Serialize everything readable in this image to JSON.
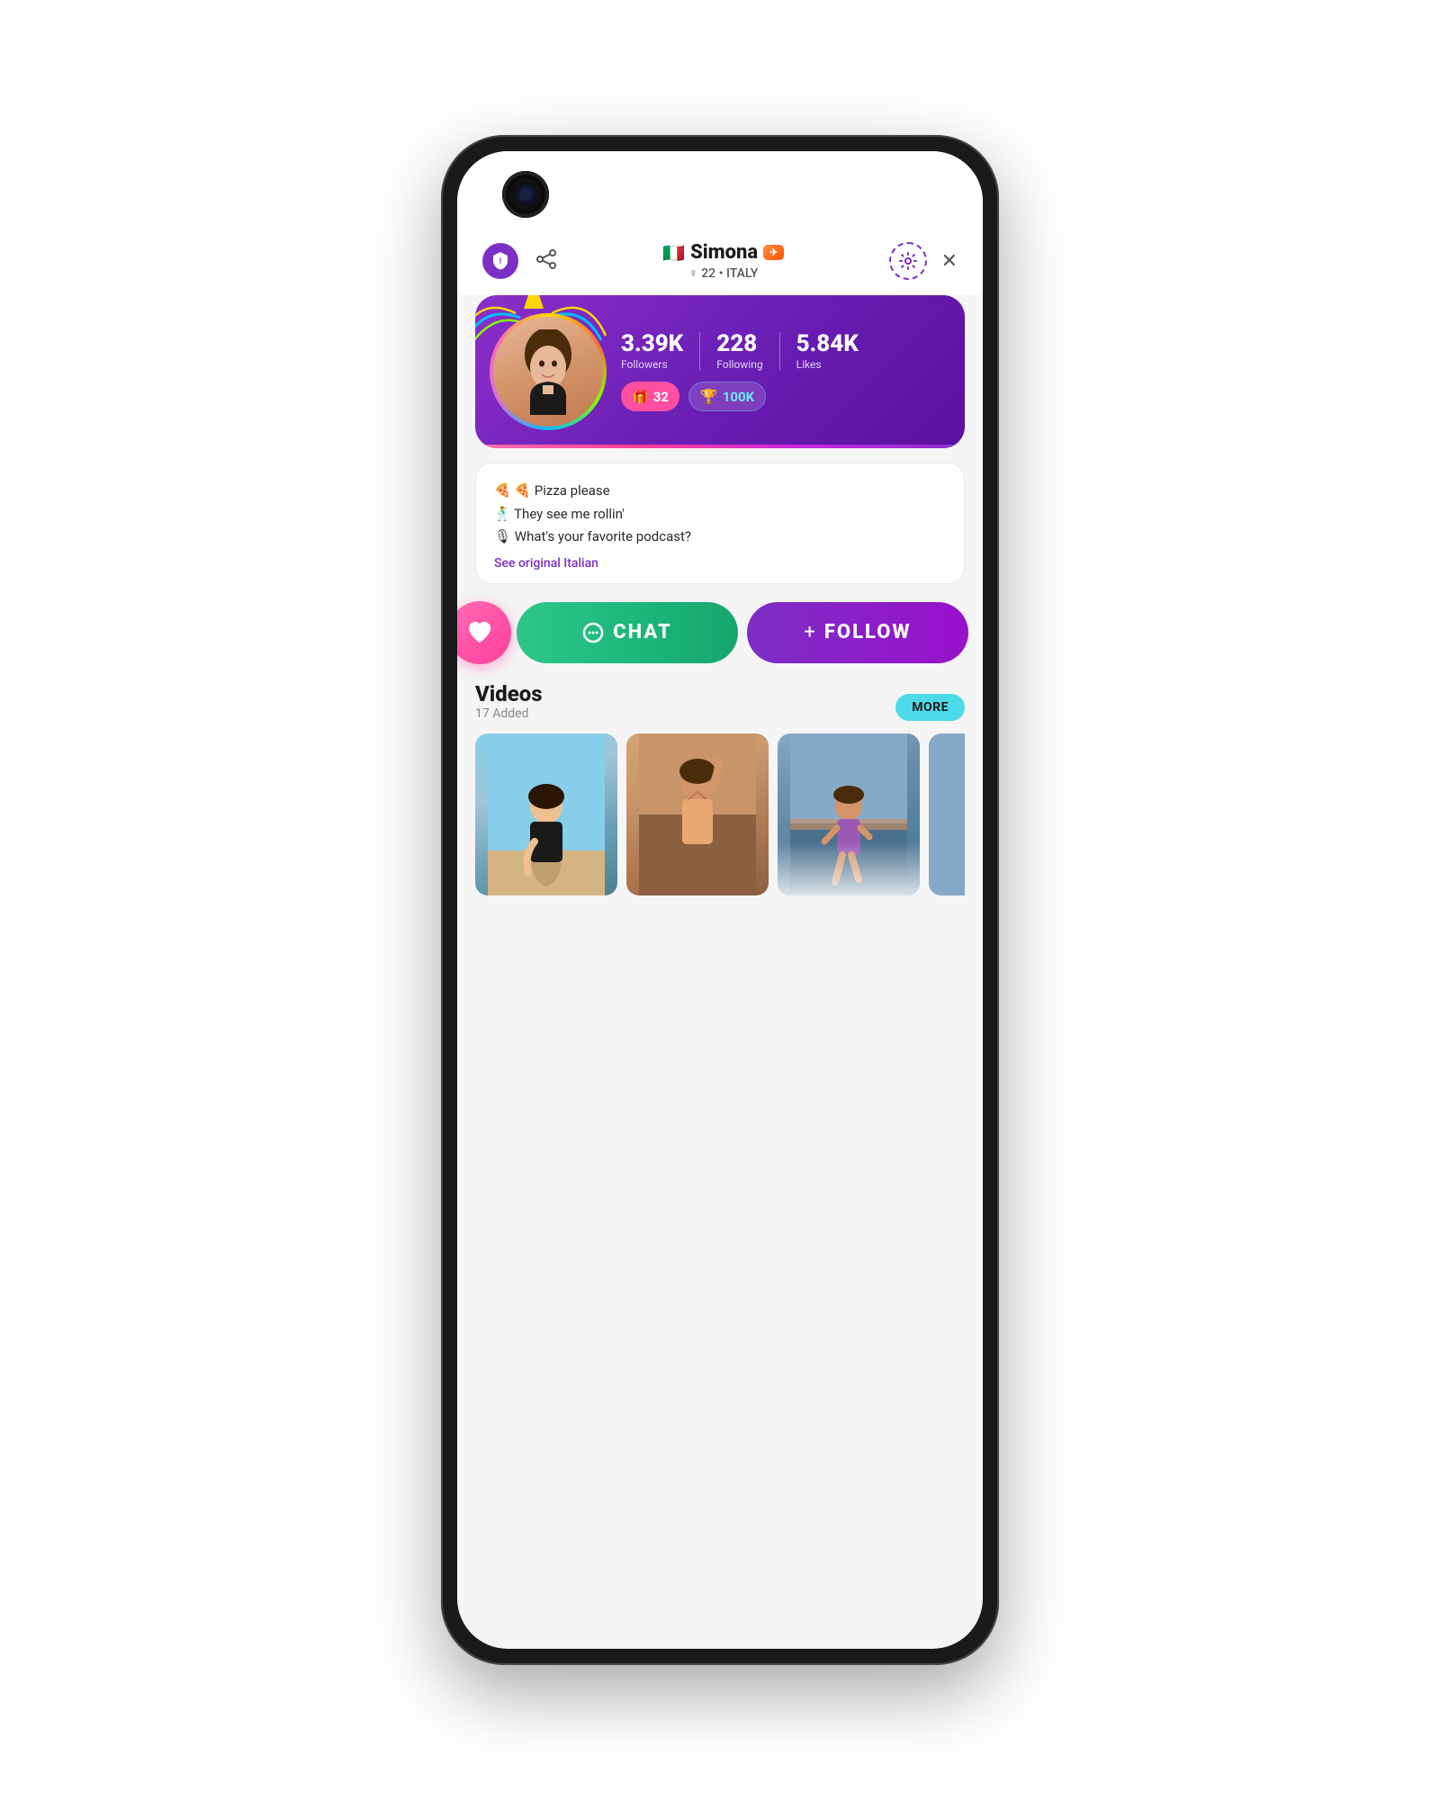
{
  "phone": {
    "camera_alt": "front camera"
  },
  "header": {
    "shield_label": "!",
    "share_label": "share",
    "name": "Simona",
    "flag_emoji": "🇮🇹",
    "verified_text": "✈",
    "gender_age": "♀ 22 • ITALY",
    "settings_label": "settings",
    "close_label": "✕"
  },
  "profile": {
    "followers_value": "3.39K",
    "followers_label": "Followers",
    "following_value": "228",
    "following_label": "Following",
    "likes_value": "5.84K",
    "likes_label": "Likes",
    "gifts_count": "32",
    "score_value": "100K"
  },
  "bio": {
    "lines": [
      "🍕 Pizza please",
      "🕺 They see me rollin'",
      "🎙 What's your favorite podcast?"
    ],
    "translate_label": "See original Italian"
  },
  "actions": {
    "chat_label": "CHAT",
    "follow_label": "FOLLOW",
    "follow_prefix": "+"
  },
  "videos": {
    "title": "Videos",
    "count_label": "17 Added",
    "more_label": "MORE"
  },
  "colors": {
    "purple": "#7b2fc4",
    "green": "#2dc78a",
    "pink": "#ff3d9a",
    "cyan": "#4dd9e8"
  }
}
